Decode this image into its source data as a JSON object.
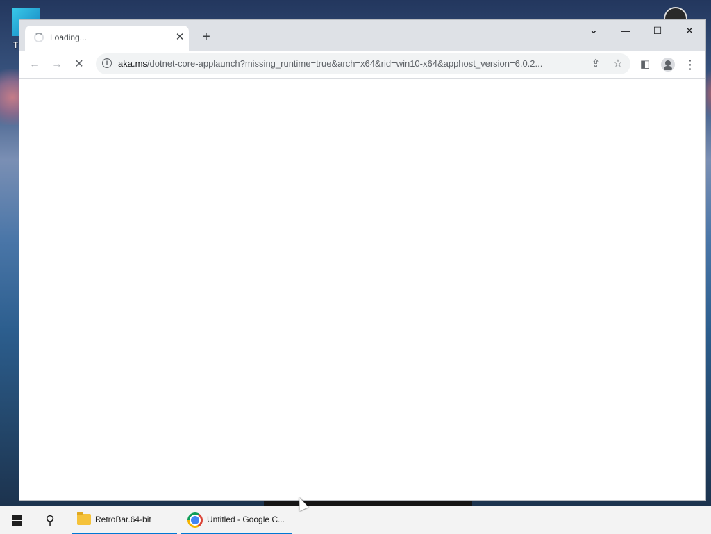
{
  "desktop": {
    "icon_label": "T"
  },
  "browser": {
    "tab": {
      "title": "Loading..."
    },
    "new_tab_label": "+",
    "window_controls": {
      "tab_search": "⌄",
      "minimize": "—",
      "maximize": "☐",
      "close": "✕"
    },
    "toolbar": {
      "back": "←",
      "forward": "→",
      "stop": "✕"
    },
    "omnibox": {
      "host": "aka.ms",
      "path": "/dotnet-core-applaunch?missing_runtime=true&arch=x64&rid=win10-x64&apphost_version=6.0.2..."
    }
  },
  "taskbar": {
    "items": [
      {
        "label": "RetroBar.64-bit",
        "icon": "folder-icon"
      },
      {
        "label": "Untitled - Google C...",
        "icon": "chrome-icon"
      }
    ],
    "accent_color": "#0078d4"
  }
}
